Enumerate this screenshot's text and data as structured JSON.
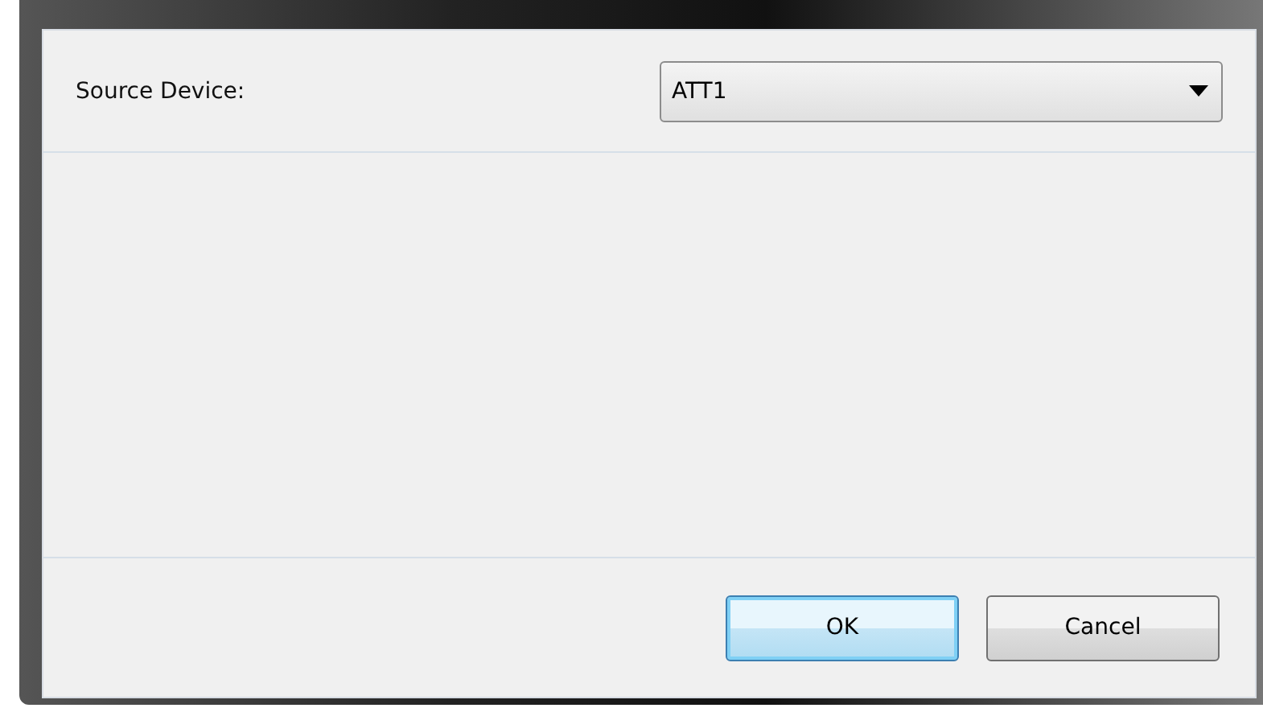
{
  "field": {
    "label": "Source Device:",
    "value": "ATT1"
  },
  "buttons": [
    {
      "label": "OK",
      "kind": "default"
    },
    {
      "label": "Cancel",
      "kind": "normal"
    }
  ]
}
